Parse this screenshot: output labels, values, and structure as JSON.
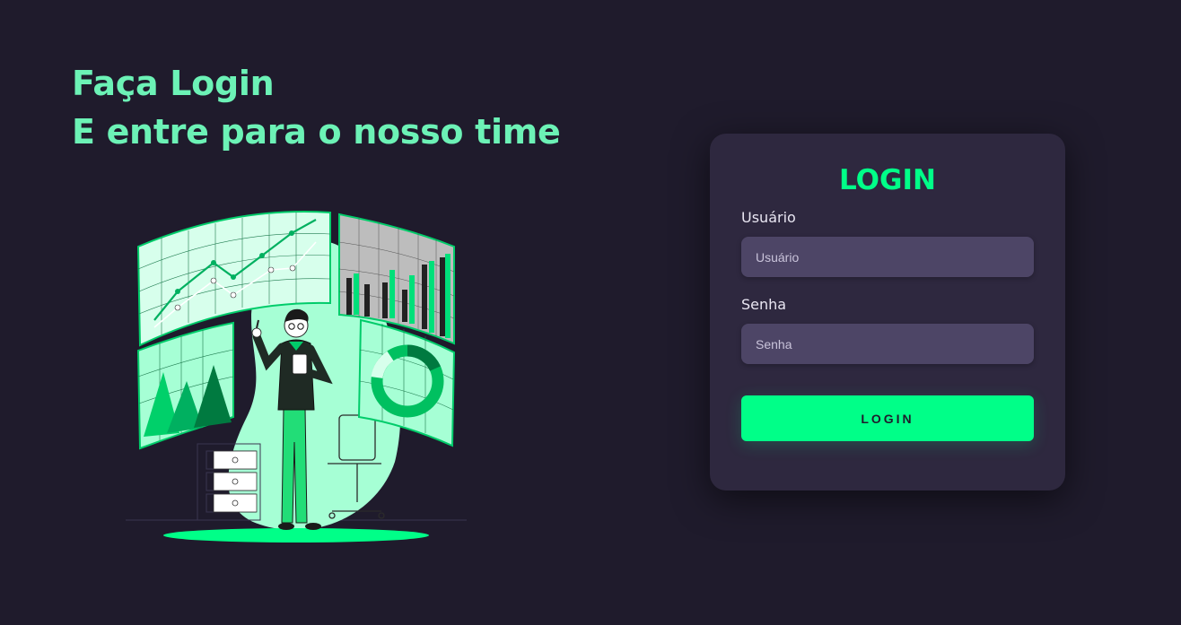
{
  "hero": {
    "line1": "Faça Login",
    "line2": "E entre para o nosso time"
  },
  "login": {
    "title": "LOGIN",
    "username_label": "Usuário",
    "username_placeholder": "Usuário",
    "password_label": "Senha",
    "password_placeholder": "Senha",
    "button_label": "LOGIN"
  },
  "colors": {
    "background": "#1f1b2c",
    "accent": "#00ff88",
    "headline": "#6cf2b6",
    "card": "#2e283f",
    "input": "#4d4566"
  }
}
